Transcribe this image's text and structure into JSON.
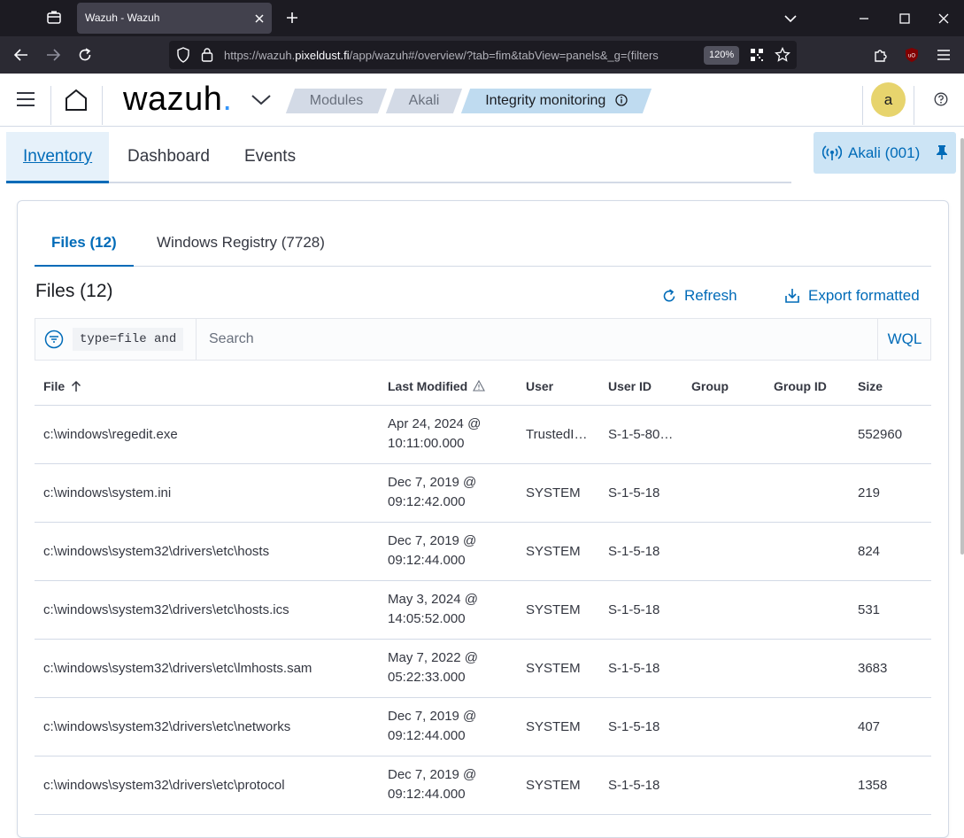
{
  "browser": {
    "tab_title": "Wazuh - Wazuh",
    "url_prefix": "https://wazuh.",
    "url_host": "pixeldust.fi",
    "url_rest": "/app/wazuh#/overview/?tab=fim&tabView=panels&_g=(filters",
    "zoom": "120%"
  },
  "header": {
    "logo_text": "wazuh",
    "logo_dot": ".",
    "breadcrumbs": [
      "Modules",
      "Akali",
      "Integrity monitoring"
    ],
    "avatar_letter": "a"
  },
  "module_tabs": [
    "Inventory",
    "Dashboard",
    "Events"
  ],
  "agent_pill": "Akali (001)",
  "sub_tabs": [
    "Files (12)",
    "Windows Registry (7728)"
  ],
  "section_title": "Files (12)",
  "actions": {
    "refresh": "Refresh",
    "export": "Export formatted"
  },
  "search": {
    "query_chip": "type=file and",
    "placeholder": "Search",
    "language": "WQL"
  },
  "table": {
    "columns": [
      "File",
      "Last Modified",
      "User",
      "User ID",
      "Group",
      "Group ID",
      "Size"
    ],
    "rows": [
      {
        "file": "c:\\windows\\regedit.exe",
        "modified_date": "Apr 24, 2024 @",
        "modified_time": "10:11:00.000",
        "user": "TrustedI…",
        "user_id": "S-1-5-80…",
        "group": "",
        "group_id": "",
        "size": "552960"
      },
      {
        "file": "c:\\windows\\system.ini",
        "modified_date": "Dec 7, 2019 @",
        "modified_time": "09:12:42.000",
        "user": "SYSTEM",
        "user_id": "S-1-5-18",
        "group": "",
        "group_id": "",
        "size": "219"
      },
      {
        "file": "c:\\windows\\system32\\drivers\\etc\\hosts",
        "modified_date": "Dec 7, 2019 @",
        "modified_time": "09:12:44.000",
        "user": "SYSTEM",
        "user_id": "S-1-5-18",
        "group": "",
        "group_id": "",
        "size": "824"
      },
      {
        "file": "c:\\windows\\system32\\drivers\\etc\\hosts.ics",
        "modified_date": "May 3, 2024 @",
        "modified_time": "14:05:52.000",
        "user": "SYSTEM",
        "user_id": "S-1-5-18",
        "group": "",
        "group_id": "",
        "size": "531"
      },
      {
        "file": "c:\\windows\\system32\\drivers\\etc\\lmhosts.sam",
        "modified_date": "May 7, 2022 @",
        "modified_time": "05:22:33.000",
        "user": "SYSTEM",
        "user_id": "S-1-5-18",
        "group": "",
        "group_id": "",
        "size": "3683"
      },
      {
        "file": "c:\\windows\\system32\\drivers\\etc\\networks",
        "modified_date": "Dec 7, 2019 @",
        "modified_time": "09:12:44.000",
        "user": "SYSTEM",
        "user_id": "S-1-5-18",
        "group": "",
        "group_id": "",
        "size": "407"
      },
      {
        "file": "c:\\windows\\system32\\drivers\\etc\\protocol",
        "modified_date": "Dec 7, 2019 @",
        "modified_time": "09:12:44.000",
        "user": "SYSTEM",
        "user_id": "S-1-5-18",
        "group": "",
        "group_id": "",
        "size": "1358"
      }
    ]
  },
  "colors": {
    "accent": "#006bb8",
    "brand_dot": "#3595f9",
    "avatar": "#e7d46d"
  }
}
